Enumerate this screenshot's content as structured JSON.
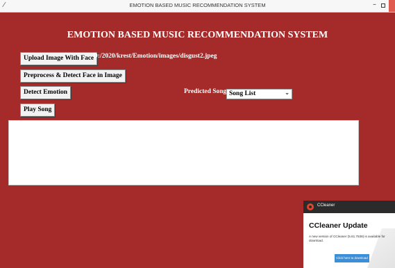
{
  "window": {
    "title": "EMOTION BASED MUSIC RECOMMENDATION SYSTEM",
    "minimize": "–"
  },
  "heading": "EMOTION BASED MUSIC RECOMMENDATION SYSTEM",
  "buttons": {
    "upload": "Upload Image With Face",
    "preprocess": "Preprocess & Detect Face in Image",
    "detect": "Detect Emotion",
    "play": "Play Song"
  },
  "image_path": "D:/2020/krest/Emotion/images/disgust2.jpeg",
  "predicted_song_label": "Predicted Song",
  "song_select": {
    "value": "Song List"
  },
  "notification": {
    "brand": "CCleaner",
    "title": "CCleaner Update",
    "body": "A new version of CCleaner (5.61.7538) is available for download.",
    "button": "Click here to download"
  },
  "colors": {
    "background": "#a52a2a",
    "close_button": "#e05a4f",
    "notification_button": "#3b8fd8"
  }
}
